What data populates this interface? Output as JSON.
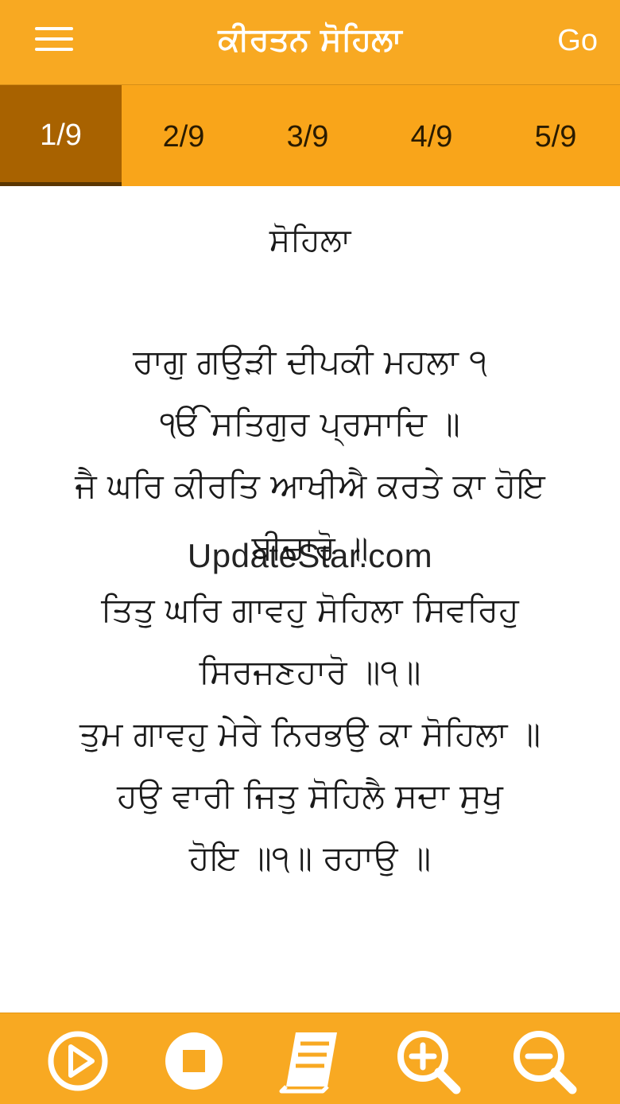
{
  "header": {
    "title": "ਕੀਰਤਨ ਸੋਹਿਲਾ",
    "menu_icon": "hamburger-menu-icon",
    "go_label": "Go"
  },
  "tabs": [
    {
      "label": "1/9",
      "active": true
    },
    {
      "label": "2/9",
      "active": false
    },
    {
      "label": "3/9",
      "active": false
    },
    {
      "label": "4/9",
      "active": false
    },
    {
      "label": "5/9",
      "active": false
    }
  ],
  "content": {
    "heading": "ਸੋਹਿਲਾ",
    "lines": [
      "ਰਾਗੁ ਗਉੜੀ ਦੀਪਕੀ ਮਹਲਾ ੧",
      "ੴ ਸਤਿਗੁਰ ਪ੍ਰਸਾਦਿ ॥",
      "ਜੈ ਘਰਿ ਕੀਰਤਿ ਆਖੀਐ ਕਰਤੇ ਕਾ ਹੋਇ",
      "ਬੀਚਾਰੋ ॥",
      "ਤਿਤੁ ਘਰਿ ਗਾਵਹੁ ਸੋਹਿਲਾ ਸਿਵਰਿਹੁ",
      "ਸਿਰਜਣਹਾਰੋ ॥੧॥",
      "ਤੁਮ ਗਾਵਹੁ ਮੇਰੇ ਨਿਰਭਉ ਕਾ ਸੋਹਿਲਾ ॥",
      "ਹਉ ਵਾਰੀ ਜਿਤੁ ਸੋਹਿਲੈ ਸਦਾ ਸੁਖੁ",
      "ਹੋਇ ॥੧॥ ਰਹਾਉ ॥"
    ],
    "watermark": "UpdateStar.com"
  },
  "bottom_bar": {
    "buttons": [
      "play-icon",
      "stop-icon",
      "book-icon",
      "zoom-in-icon",
      "zoom-out-icon"
    ]
  },
  "colors": {
    "bar_orange": "#f8a922",
    "tab_active": "#a86200",
    "text": "#1a1a1a"
  }
}
